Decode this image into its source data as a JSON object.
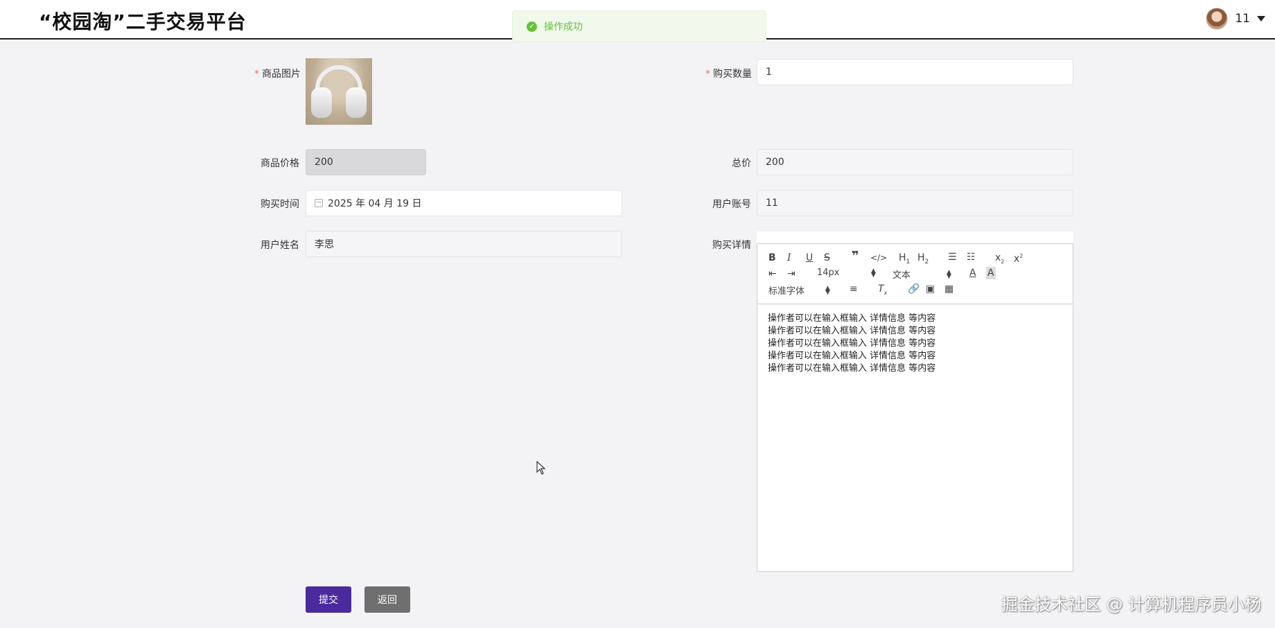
{
  "header": {
    "title": "“校园淘”二手交易平台",
    "user_name": "11"
  },
  "toast": {
    "message": "操作成功"
  },
  "form": {
    "image_label": "商品图片",
    "quantity_label": "购买数量",
    "quantity_value": "1",
    "price_label": "商品价格",
    "price_value": "200",
    "total_label": "总价",
    "total_value": "200",
    "time_label": "购买时间",
    "time_value": "2025 年 04 月 19 日",
    "account_label": "用户账号",
    "account_value": "11",
    "name_label": "用户姓名",
    "name_value": "李思",
    "detail_label": "购买详情"
  },
  "editor": {
    "font_size": "14px",
    "header_type": "文本",
    "font_family": "标准字体",
    "lines": [
      "操作者可以在输入框输入  详情信息  等内容",
      "操作者可以在输入框输入  详情信息  等内容",
      "操作者可以在输入框输入  详情信息  等内容",
      "操作者可以在输入框输入  详情信息  等内容",
      "操作者可以在输入框输入  详情信息  等内容"
    ]
  },
  "buttons": {
    "submit": "提交",
    "back": "返回"
  },
  "watermark": "掘金技术社区 @ 计算机程序员小杨"
}
